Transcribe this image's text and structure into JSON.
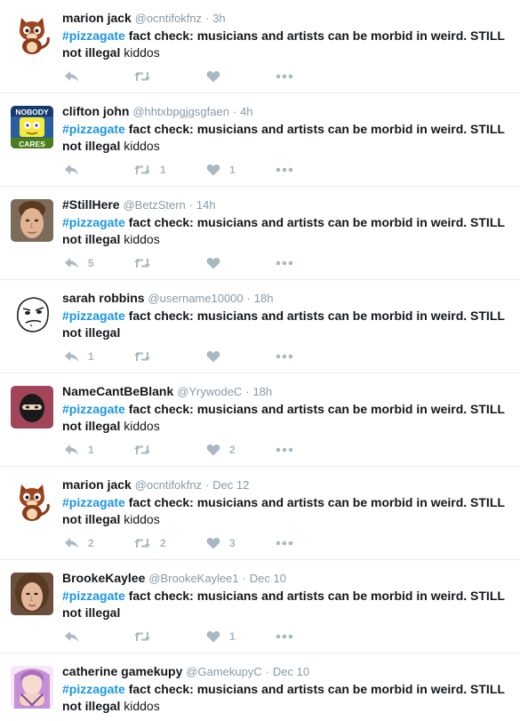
{
  "colors": {
    "link": "#1b95e0",
    "muted": "#8899a6",
    "icon": "#aab8c2",
    "divider": "#e6ecf0"
  },
  "tweets": [
    {
      "avatar": "cartoon-cat-avatar",
      "fullname": "marion jack",
      "username": "@ocntifokfnz",
      "time": "3h",
      "hashtag": "#pizzagate",
      "text": "fact check: musicians and artists can be morbid in weird. STILL not illegal",
      "tail": "kiddos",
      "replies": "",
      "retweets": "",
      "likes": ""
    },
    {
      "avatar": "nobody-cares-avatar",
      "avatar_text_top": "NOBODY",
      "avatar_text_bottom": "CARES",
      "fullname": "clifton john",
      "username": "@hhtxbpgjgsgfaen",
      "time": "4h",
      "hashtag": "#pizzagate",
      "text": "fact check: musicians and artists can be morbid in weird. STILL not illegal",
      "tail": "kiddos",
      "replies": "",
      "retweets": "1",
      "likes": "1"
    },
    {
      "avatar": "photo-face-avatar",
      "fullname": "#StillHere",
      "username": "@BetzStern",
      "time": "14h",
      "hashtag": "#pizzagate",
      "text": "fact check: musicians and artists can be morbid in weird. STILL not illegal",
      "tail": "kiddos",
      "replies": "5",
      "retweets": "",
      "likes": ""
    },
    {
      "avatar": "meme-face-avatar",
      "fullname": "sarah robbins",
      "username": "@username10000",
      "time": "18h",
      "hashtag": "#pizzagate",
      "text": "fact check: musicians and artists can be morbid in weird. STILL not illegal",
      "tail": "",
      "replies": "1",
      "retweets": "",
      "likes": ""
    },
    {
      "avatar": "ninja-avatar",
      "fullname": "NameCantBeBlank",
      "username": "@YrywodeC",
      "time": "18h",
      "hashtag": "#pizzagate",
      "text": "fact check: musicians and artists can be morbid in weird. STILL not illegal",
      "tail": "kiddos",
      "replies": "1",
      "retweets": "",
      "likes": "2"
    },
    {
      "avatar": "cartoon-cat-avatar",
      "fullname": "marion jack",
      "username": "@ocntifokfnz",
      "time": "Dec 12",
      "hashtag": "#pizzagate",
      "text": "fact check: musicians and artists can be morbid in weird. STILL not illegal",
      "tail": "kiddos",
      "replies": "2",
      "retweets": "2",
      "likes": "3"
    },
    {
      "avatar": "photo-face-avatar-female",
      "fullname": "BrookeKaylee",
      "username": "@BrookeKaylee1",
      "time": "Dec 10",
      "hashtag": "#pizzagate",
      "text": "fact check: musicians and artists can be morbid in weird. STILL not illegal",
      "tail": "",
      "replies": "",
      "retweets": "",
      "likes": "1"
    },
    {
      "avatar": "anime-avatar",
      "fullname": "catherine gamekupy",
      "username": "@GamekupyC",
      "time": "Dec 10",
      "hashtag": "#pizzagate",
      "text": "fact check: musicians and artists can be morbid in weird. STILL not illegal",
      "tail": "kiddos",
      "replies": "",
      "retweets": "",
      "likes": ""
    }
  ]
}
